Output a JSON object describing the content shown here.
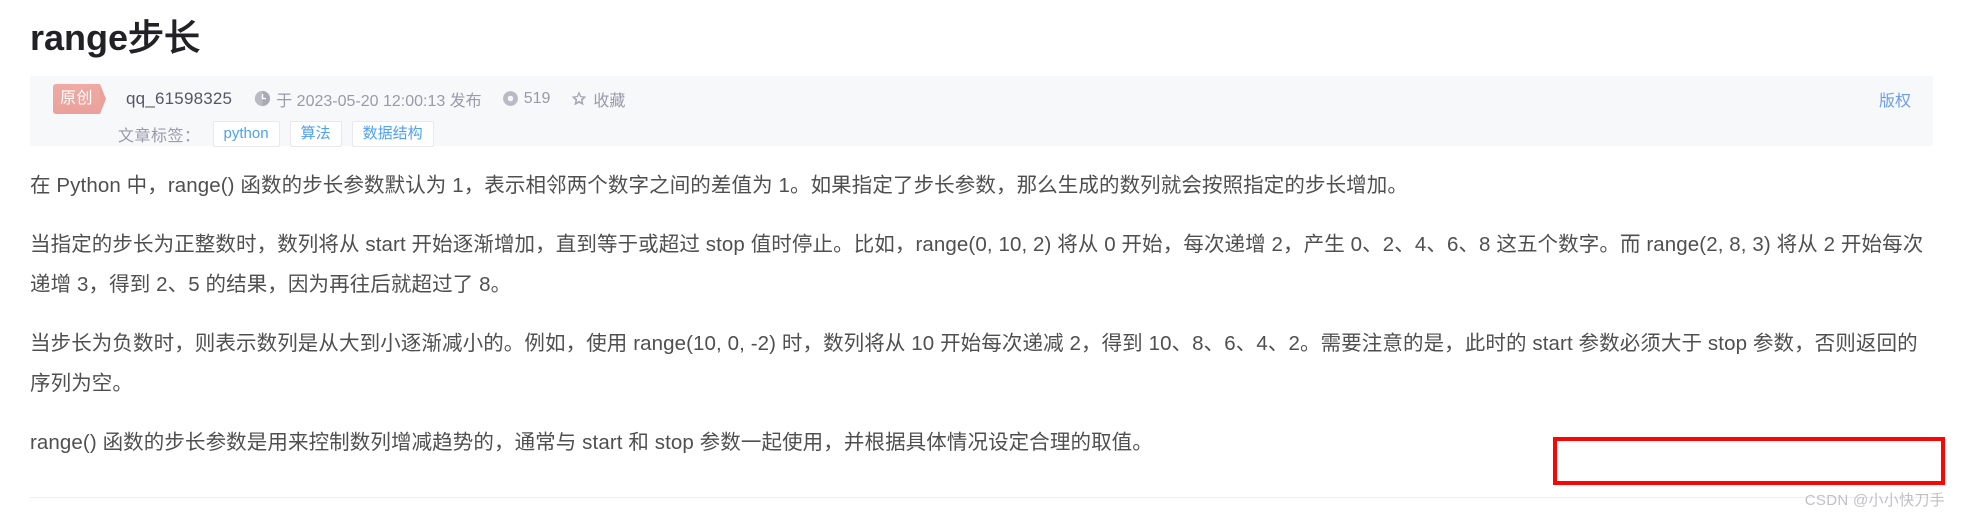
{
  "article": {
    "title": "range步长",
    "meta": {
      "badge": "原创",
      "author": "qq_61598325",
      "clock_icon": "clock-icon",
      "published": "于 2023-05-20 12:00:13 发布",
      "views_icon": "eye-icon",
      "views": "519",
      "favorite_icon": "star-icon",
      "favorite_label": "收藏",
      "copyright": "版权"
    },
    "tags": {
      "label": "文章标签：",
      "items": [
        "python",
        "算法",
        "数据结构"
      ]
    },
    "paragraphs": [
      "在 Python 中，range() 函数的步长参数默认为 1，表示相邻两个数字之间的差值为 1。如果指定了步长参数，那么生成的数列就会按照指定的步长增加。",
      "当指定的步长为正整数时，数列将从 start 开始逐渐增加，直到等于或超过 stop 值时停止。比如，range(0, 10, 2) 将从 0 开始，每次递增 2，产生 0、2、4、6、8 这五个数字。而 range(2, 8, 3) 将从 2 开始每次递增 3，得到 2、5 的结果，因为再往后就超过了 8。",
      "当步长为负数时，则表示数列是从大到小逐渐减小的。例如，使用 range(10, 0, -2) 时，数列将从 10 开始每次递减 2，得到 10、8、6、4、2。需要注意的是，此时的 start 参数必须大于 stop 参数，否则返回的序列为空。",
      "range() 函数的步长参数是用来控制数列增减趋势的，通常与 start 和 stop 参数一起使用，并根据具体情况设定合理的取值。"
    ],
    "annotation": {
      "name": "red-highlight-box",
      "color": "#fb0505"
    },
    "watermark": "CSDN @小小快刀手"
  },
  "colors": {
    "title": "#222226",
    "body_text": "#4f4f4f",
    "meta_text": "#999aaa",
    "tag_text": "#4ea1f0",
    "badge_bg": "#eaa19b",
    "meta_bg": "#f7f8fa",
    "link": "#6b9fe6",
    "annotation": "#fb0505",
    "watermark": "#c0c0c6"
  }
}
